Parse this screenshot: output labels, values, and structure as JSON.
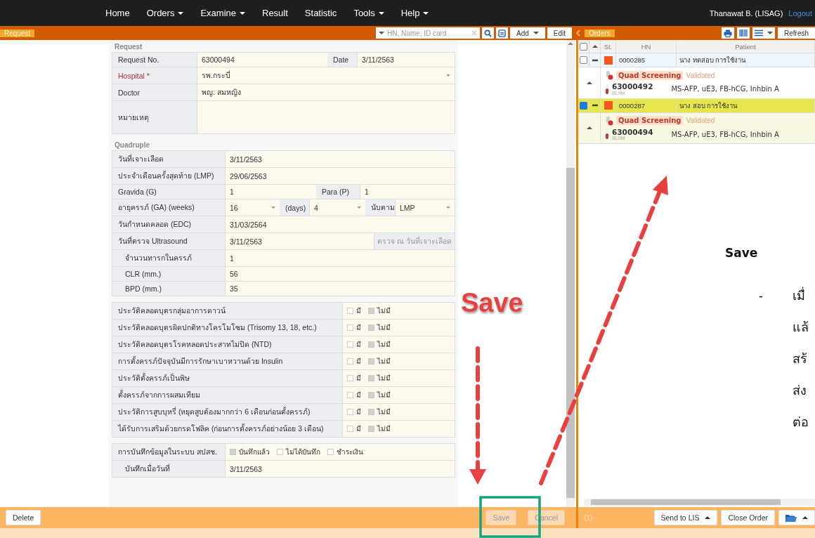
{
  "nav": {
    "items": [
      {
        "label": "Home",
        "dropdown": false
      },
      {
        "label": "Orders",
        "dropdown": true
      },
      {
        "label": "Examine",
        "dropdown": true
      },
      {
        "label": "Result",
        "dropdown": false
      },
      {
        "label": "Statistic",
        "dropdown": false
      },
      {
        "label": "Tools",
        "dropdown": true
      },
      {
        "label": "Help",
        "dropdown": true
      }
    ],
    "user": "Thanawat B. (LISAG)",
    "logout": "Logout"
  },
  "toolbar": {
    "request_tab": "Request",
    "search": {
      "placeholder": "HN, Name, ID card"
    },
    "add": "Add",
    "edit": "Edit",
    "orders_tab": "Orders",
    "refresh": "Refresh"
  },
  "request": {
    "title": "Request",
    "rows": [
      {
        "kind": "pair",
        "label": "Request No.",
        "value": "63000494",
        "label2": "Date",
        "value2": "3/11/2563"
      },
      {
        "kind": "select",
        "label": "Hospital *",
        "required": true,
        "value": "รพ.กระบี่"
      },
      {
        "kind": "text",
        "label": "Doctor",
        "value": "พญ. สมหญิง"
      },
      {
        "kind": "textarea",
        "label": "หมายเหตุ"
      }
    ]
  },
  "quadruple": {
    "title": "Quadruple",
    "rows": [
      {
        "kind": "text",
        "label": "วันที่เจาะเลือด",
        "value": "3/11/2563"
      },
      {
        "kind": "text",
        "label": "ประจำเดือนครั้งสุดท้าย (LMP)",
        "value": "29/06/2563"
      },
      {
        "kind": "pair",
        "label": "Gravida (G)",
        "value": "1",
        "label2": "Para (P)",
        "value2": "1"
      },
      {
        "kind": "ga",
        "label": "อายุครรภ์ (GA) (weeks)",
        "value": "16",
        "days_label": "(days)",
        "days": "4",
        "basis_label": "นับตาม",
        "basis": "LMP"
      },
      {
        "kind": "text",
        "label": "วันกำหนดคลอด (EDC)",
        "value": "31/03/2564"
      },
      {
        "kind": "ultrasound",
        "label": "วันที่ตรวจ Ultrasound",
        "value": "3/11/2563",
        "button": "ตรวจ ณ วันที่เจาะเลือด",
        "children": [
          {
            "kind": "text",
            "label": "จำนวนทารกในครรภ์",
            "value": "1"
          },
          {
            "kind": "text",
            "label": "CLR (mm.)",
            "value": "56"
          },
          {
            "kind": "text",
            "label": "BPD (mm.)",
            "value": "35"
          }
        ]
      }
    ],
    "history": [
      {
        "label": "ประวัติคลอดบุตรกลุ่มอาการดาวน์",
        "options": [
          {
            "label": "มี",
            "checked": false
          },
          {
            "label": "ไม่มี",
            "checked": true
          }
        ]
      },
      {
        "label": "ประวัติคลอดบุตรผิดปกติทางโครโมโซม (Trisomy 13, 18, etc.)",
        "options": [
          {
            "label": "มี",
            "checked": false
          },
          {
            "label": "ไม่มี",
            "checked": true
          }
        ]
      },
      {
        "label": "ประวัติคลอดบุตรโรคหลอดประสาทไม่ปิด (NTD)",
        "options": [
          {
            "label": "มี",
            "checked": false
          },
          {
            "label": "ไม่มี",
            "checked": true
          }
        ]
      },
      {
        "label": "การตั้งครรภ์ปัจจุบันมีการรักษาเบาหวานด้วย Insulin",
        "options": [
          {
            "label": "มี",
            "checked": false
          },
          {
            "label": "ไม่มี",
            "checked": true
          }
        ]
      },
      {
        "label": "ประวัติตั้งครรภ์เป็นพิษ",
        "options": [
          {
            "label": "มี",
            "checked": false
          },
          {
            "label": "ไม่มี",
            "checked": true
          }
        ]
      },
      {
        "label": "ตั้งครรภ์จากการผสมเทียม",
        "options": [
          {
            "label": "มี",
            "checked": false
          },
          {
            "label": "ไม่มี",
            "checked": true
          }
        ]
      },
      {
        "label": "ประวัติการสูบบุหรี่ (หยุดสูบต้องมากกว่า 6 เดือนก่อนตั้งครรภ์)",
        "options": [
          {
            "label": "มี",
            "checked": false
          },
          {
            "label": "ไม่มี",
            "checked": true
          }
        ]
      },
      {
        "label": "ได้รับการเสริมด้วยกรดโฟลิค (ก่อนการตั้งครรภ์อย่างน้อย 3 เดือน)",
        "options": [
          {
            "label": "มี",
            "checked": false
          },
          {
            "label": "ไม่มี",
            "checked": true
          }
        ]
      }
    ],
    "record": {
      "label": "การบันทึกข้อมูลในระบบ สปสช.",
      "options": [
        {
          "label": "บันทึกแล้ว",
          "checked": true
        },
        {
          "label": "ไม่ได้บันทึก",
          "checked": false
        },
        {
          "label": "ชำระเงิน",
          "checked": false
        }
      ],
      "date_label": "บันทึกเมื่อวันที่",
      "date": "3/11/2563"
    }
  },
  "orders": {
    "all_selected": false,
    "columns": [
      "St.",
      "HN",
      "Patient"
    ],
    "groups": [
      {
        "selected": false,
        "color": "#f4581c",
        "hn": "0000285",
        "patient": "นาง ทดสอบ การใช้งาน",
        "test": "Quad Screening",
        "status": "Validated",
        "request_no": "63000492",
        "specimen": "BL/IM",
        "tests": "MS-AFP, uE3, FB-hCG, Inhbin A"
      },
      {
        "selected": true,
        "color": "#f4581c",
        "hn": "0000287",
        "patient": "นาง สอบ การใช้งาน",
        "test": "Quad Screening",
        "status": "Validated",
        "request_no": "63000494",
        "specimen": "BL/IM",
        "tests": "MS-AFP, uE3, FB-hCG, Inhbin A"
      }
    ]
  },
  "footer": {
    "delete": "Delete",
    "buttons": [
      {
        "label": "Save",
        "disabled": true
      },
      {
        "label": "Cancel",
        "disabled": true
      }
    ],
    "count": "(1)",
    "send": "Send to LIS",
    "close": "Close Order"
  },
  "annotation": {
    "callout": "Save",
    "heading": "Save",
    "bullet": "-",
    "lines": [
      "เมื่",
      "แล้",
      "สร้",
      "ส่ง",
      "ต่อ"
    ]
  }
}
